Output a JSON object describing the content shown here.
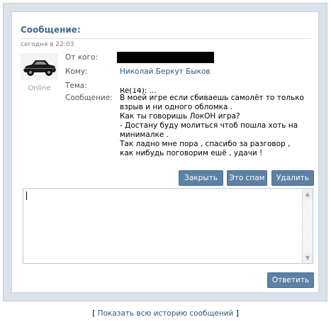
{
  "message": {
    "title": "Сообщение:",
    "date": "сегодня в 22:03",
    "status": "Online",
    "labels": {
      "from": "От кого:",
      "to": "Кому:",
      "subject": "Тема:",
      "body": "Сообщение:"
    },
    "to_name": "Николай Беркут Быков",
    "subject": "Re(14): ...",
    "body_lines": [
      "В моей игре если сбиваешь самолёт то только",
      "взрыв и ни одного обломка .",
      "Как ты говоришь ЛокОН игра?",
      "- Достану буду молиться чтоб пошла хоть на",
      "минималке .",
      "Так ладно мне пора , спасибо за разговор ,",
      "как нибудь поговорим ешё , удачи !"
    ]
  },
  "actions": {
    "close": "Закрыть",
    "spam": "Это спам",
    "delete": "Удалить",
    "reply": "Ответить"
  },
  "reply": {
    "value": ""
  },
  "footer": {
    "open_bracket": "[",
    "history_link": "Показать всю историю сообщений",
    "close_bracket": "]"
  },
  "colors": {
    "accent": "#45688e",
    "button": "#5d80a6",
    "link": "#2b587a"
  }
}
